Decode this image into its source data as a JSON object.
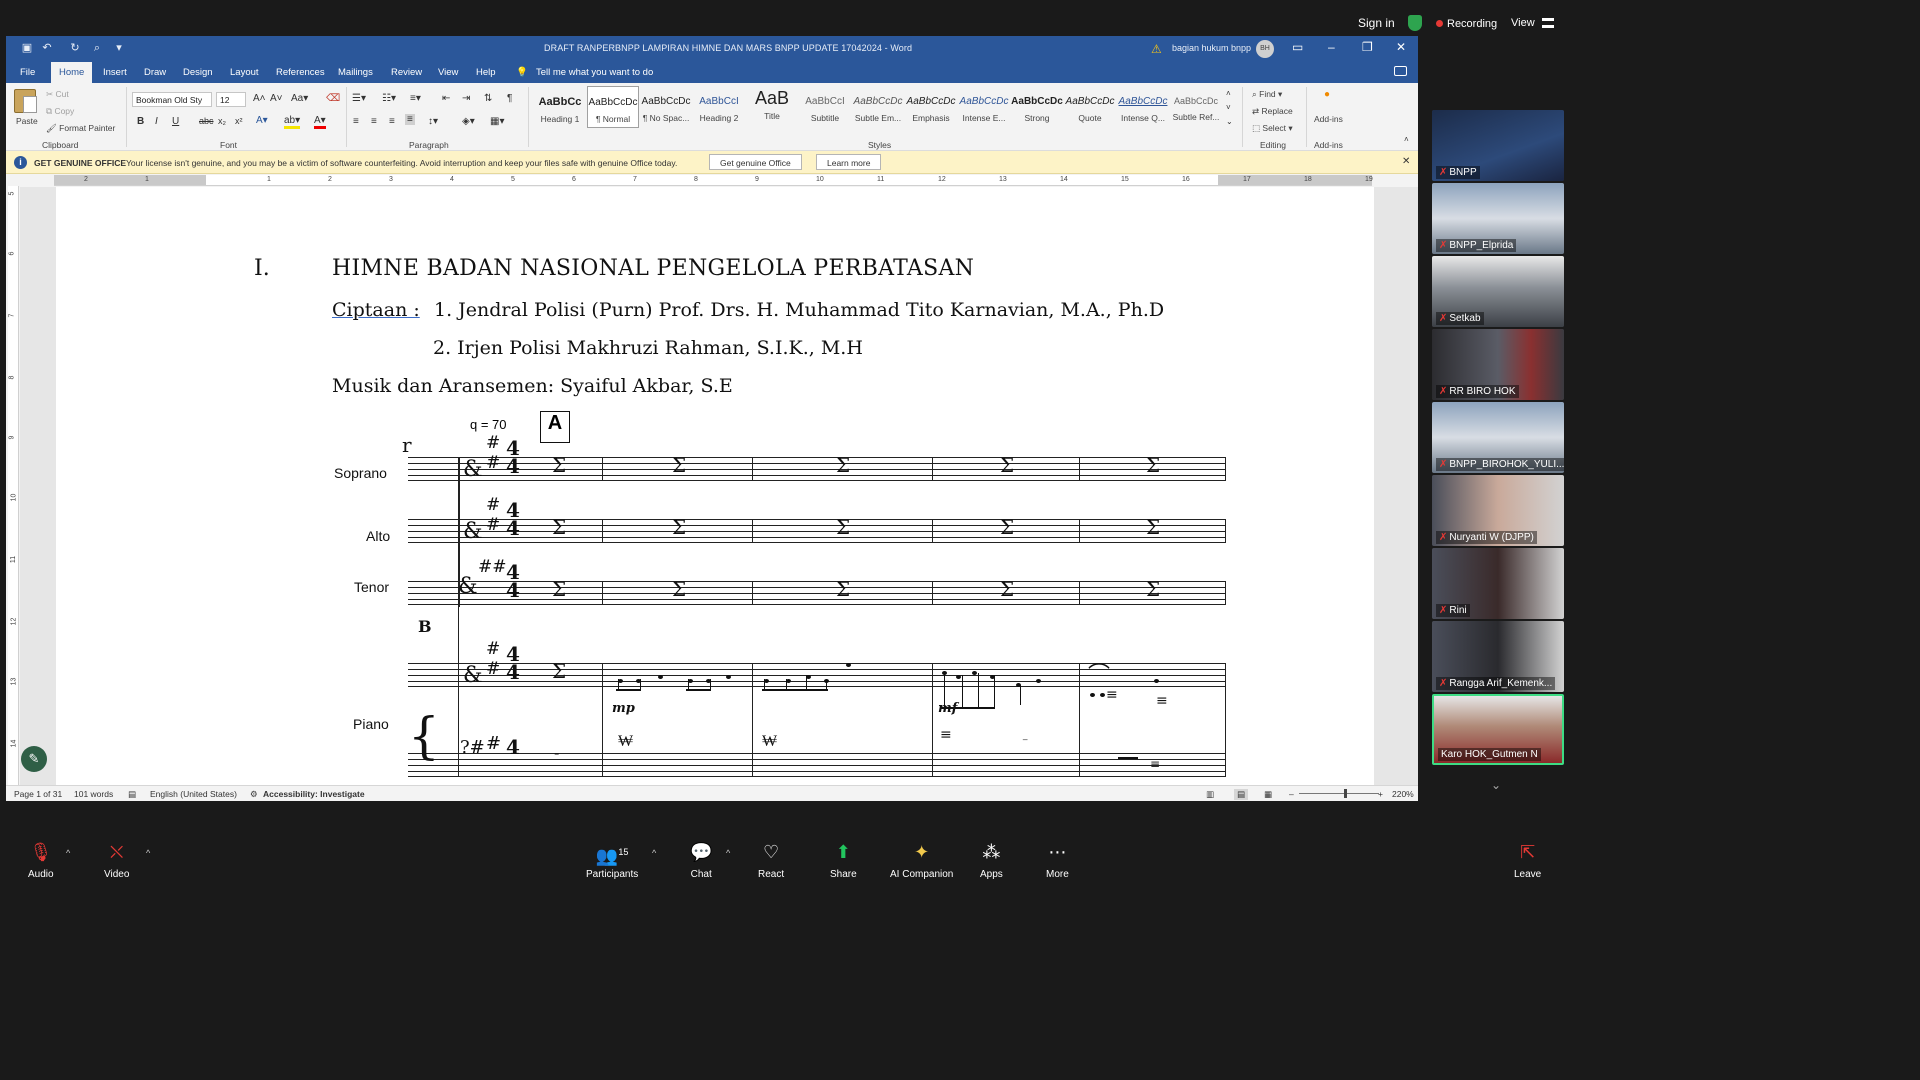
{
  "zoom_top": {
    "signin": "Sign in",
    "recording": "Recording",
    "view": "View"
  },
  "word": {
    "title": "DRAFT RANPERBNPP LAMPIRAN HIMNE DAN MARS BNPP UPDATE 17042024  -  Word",
    "user": "bagian hukum bnpp",
    "avatar": "BH",
    "tabs": [
      "File",
      "Home",
      "Insert",
      "Draw",
      "Design",
      "Layout",
      "References",
      "Mailings",
      "Review",
      "View",
      "Help"
    ],
    "tell_me": "Tell me what you want to do",
    "clipboard": {
      "paste": "Paste",
      "cut": "Cut",
      "copy": "Copy",
      "format_painter": "Format Painter",
      "label": "Clipboard"
    },
    "font": {
      "name": "Bookman Old Sty",
      "size": "12",
      "label": "Font"
    },
    "paragraph": {
      "label": "Paragraph"
    },
    "styles": {
      "label": "Styles",
      "items": [
        {
          "preview": "AaBbCc",
          "name": "Heading 1"
        },
        {
          "preview": "AaBbCcDc",
          "name": "¶ Normal"
        },
        {
          "preview": "AaBbCcDc",
          "name": "¶ No Spac..."
        },
        {
          "preview": "AaBbCcI",
          "name": "Heading 2"
        },
        {
          "preview": "AaB",
          "name": "Title"
        },
        {
          "preview": "AaBbCcI",
          "name": "Subtitle"
        },
        {
          "preview": "AaBbCcDc",
          "name": "Subtle Em..."
        },
        {
          "preview": "AaBbCcDc",
          "name": "Emphasis"
        },
        {
          "preview": "AaBbCcDc",
          "name": "Intense E..."
        },
        {
          "preview": "AaBbCcDc",
          "name": "Strong"
        },
        {
          "preview": "AaBbCcDc",
          "name": "Quote"
        },
        {
          "preview": "AaBbCcDc",
          "name": "Intense Q..."
        },
        {
          "preview": "AaBbCcDc",
          "name": "Subtle Ref..."
        }
      ]
    },
    "editing": {
      "find": "Find",
      "replace": "Replace",
      "select": "Select",
      "label": "Editing"
    },
    "addins": {
      "button": "Add-ins",
      "label": "Add-ins"
    },
    "infobar": {
      "label": "GET GENUINE OFFICE",
      "message": "Your license isn't genuine, and you may be a victim of software counterfeiting. Avoid interruption and keep your files safe with genuine Office today.",
      "btn_genuine": "Get genuine Office",
      "btn_learn": "Learn more"
    },
    "ruler_numbers": [
      "2",
      "1",
      "1",
      "2",
      "3",
      "4",
      "5",
      "6",
      "7",
      "8",
      "9",
      "10",
      "11",
      "12",
      "13",
      "14",
      "15",
      "16",
      "17",
      "18",
      "19"
    ],
    "vruler_numbers": [
      "5",
      "6",
      "7",
      "8",
      "9",
      "10",
      "11",
      "12",
      "13",
      "14"
    ],
    "document": {
      "heading_num": "I.",
      "heading": "HIMNE BADAN NASIONAL PENGELOLA PERBATASAN",
      "ciptaan_label": "Ciptaan :",
      "composer1": "1. Jendral Polisi (Purn) Prof. Drs. H. Muhammad Tito Karnavian, M.A., Ph.D",
      "composer2": "2. Irjen Polisi Makhruzi Rahman, S.I.K., M.H",
      "arranger": "Musik dan Aransemen: Syaiful Akbar, S.E",
      "score": {
        "tempo": "q = 70",
        "rehearsal_a": "A",
        "rehearsal_b": "B",
        "parts": [
          "Soprano",
          "Alto",
          "Tenor",
          "Piano"
        ],
        "dyn_mp": "mp",
        "dyn_mf": "mf"
      }
    },
    "status": {
      "page": "Page 1 of 31",
      "words": "101 words",
      "language": "English (United States)",
      "accessibility": "Accessibility: Investigate",
      "zoom": "220%"
    }
  },
  "participants": [
    {
      "name": "BNPP",
      "bg": "#2a3a55"
    },
    {
      "name": "BNPP_Elprida",
      "bg": "#6d7d92"
    },
    {
      "name": "Setkab",
      "bg": "#55606a"
    },
    {
      "name": "RR BIRO HOK",
      "bg": "#4a4a52"
    },
    {
      "name": "BNPP_BIROHOK_YULI...",
      "bg": "#6a7a90"
    },
    {
      "name": "Nuryanti W (DJPP)",
      "bg": "#5b5f68"
    },
    {
      "name": "Rini",
      "bg": "#5e6470"
    },
    {
      "name": "Rangga Arif_Kemenk...",
      "bg": "#565b66"
    },
    {
      "name": "Karo HOK_Gutmen N",
      "bg": "#a8a8a8"
    }
  ],
  "zoom_bottom": {
    "audio": "Audio",
    "video": "Video",
    "participants": "Participants",
    "participants_count": "15",
    "chat": "Chat",
    "react": "React",
    "share": "Share",
    "ai": "AI Companion",
    "apps": "Apps",
    "more": "More",
    "leave": "Leave"
  }
}
